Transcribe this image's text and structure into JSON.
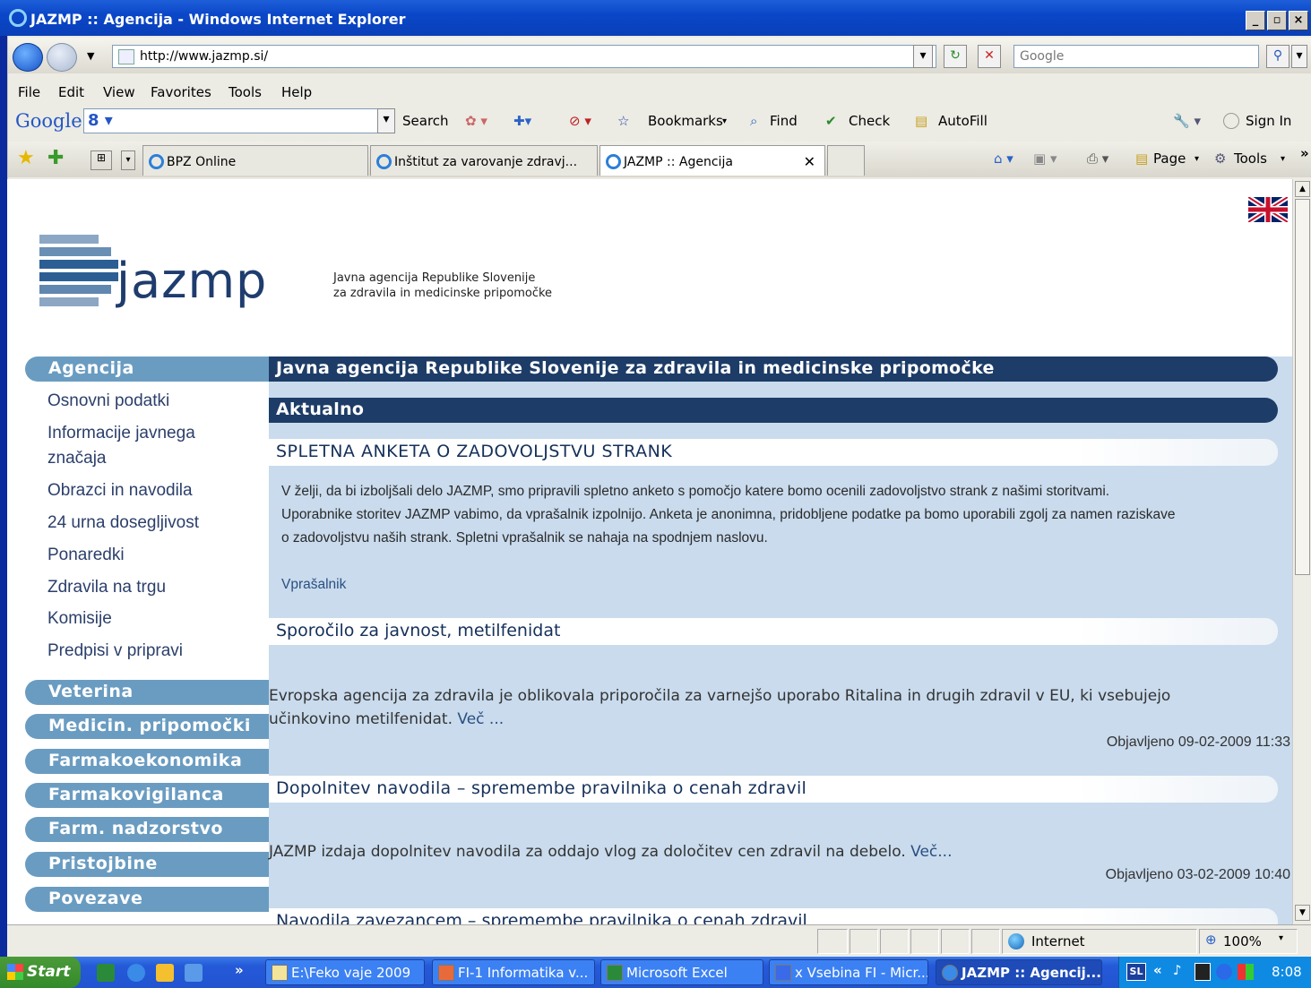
{
  "window": {
    "title": "JAZMP :: Agencija - Windows Internet Explorer"
  },
  "address": {
    "url": "http://www.jazmp.si/",
    "search_placeholder": "Google"
  },
  "menu": [
    "File",
    "Edit",
    "View",
    "Favorites",
    "Tools",
    "Help"
  ],
  "google_toolbar": {
    "logo": "Google",
    "search_label": "Search",
    "bookmarks_label": "Bookmarks",
    "find_label": "Find",
    "check_label": "Check",
    "autofill_label": "AutoFill",
    "signin_label": "Sign In"
  },
  "tabs": [
    {
      "label": "BPZ Online"
    },
    {
      "label": "Inštitut za varovanje zdravj..."
    },
    {
      "label": "JAZMP :: Agencija"
    }
  ],
  "command_bar": {
    "page_label": "Page",
    "tools_label": "Tools"
  },
  "site": {
    "logo_text": "jazmp",
    "tagline_1": "Javna agencija Republike Slovenije",
    "tagline_2": "za zdravila in medicinske pripomočke"
  },
  "leftnav": {
    "agencija": "Agencija",
    "agencija_items": [
      "Osnovni podatki",
      "Informacije javnega",
      "značaja",
      "Obrazci in navodila",
      "24 urna dosegljivost",
      "Ponaredki",
      "Zdravila na trgu",
      "Komisije",
      "Predpisi v pripravi"
    ],
    "sections": [
      "Veterina",
      "Medicin. pripomočki",
      "Farmakoekonomika",
      "Farmakovigilanca",
      "Farm. nadzorstvo",
      "Pristojbine",
      "Povezave"
    ]
  },
  "content": {
    "header": "Javna agencija Republike Slovenije za zdravila in medicinske pripomočke",
    "aktualno": "Aktualno",
    "news": [
      {
        "title": "SPLETNA ANKETA O ZADOVOLJSTVU STRANK",
        "line1": "V želji, da bi izboljšali delo JAZMP, smo pripravili spletno anketo s pomočjo katere bomo ocenili zadovoljstvo strank z našimi storitvami.",
        "line2": "Uporabnike storitev JAZMP vabimo, da vprašalnik izpolnijo. Anketa je anonimna, pridobljene podatke pa bomo uporabili zgolj za namen raziskave",
        "line3": "o zadovoljstvu naših strank. Spletni vprašalnik se nahaja na spodnjem naslovu.",
        "link": "Vprašalnik"
      },
      {
        "title": "Sporočilo za javnost, metilfenidat",
        "line1": "Evropska agencija za zdravila je oblikovala priporočila za varnejšo uporabo Ritalina in drugih zdravil v EU, ki vsebujejo",
        "line2": "učinkovino metilfenidat.",
        "more": "Več ...",
        "date": "Objavljeno 09-02-2009 11:33"
      },
      {
        "title": "Dopolnitev navodila – spremembe pravilnika o cenah zdravil",
        "line1": "JAZMP izdaja dopolnitev navodila za oddajo vlog za določitev cen zdravil na debelo.",
        "more": "Več...",
        "date": "Objavljeno 03-02-2009 10:40"
      },
      {
        "title": "Navodila zavezancem – spremembe pravilnika o cenah zdravil"
      }
    ]
  },
  "status": {
    "zone": "Internet",
    "zoom": "100%"
  },
  "taskbar": {
    "start": "Start",
    "tasks": [
      "E:\\Feko vaje 2009",
      "FI-1 Informatika v...",
      "Microsoft Excel",
      "x Vsebina FI - Micr...",
      "JAZMP :: Agencij..."
    ],
    "lang": "SL",
    "clock": "8:08"
  }
}
